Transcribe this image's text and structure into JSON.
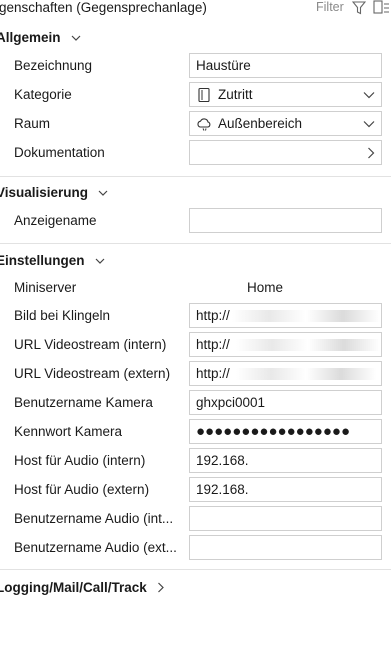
{
  "header": {
    "title": "igenschaften (Gegensprechanlage)",
    "filter_label": "Filter"
  },
  "sections": {
    "allgemein": "Allgemein",
    "visualisierung": "Visualisierung",
    "einstellungen": "Einstellungen",
    "logging": "Logging/Mail/Call/Track"
  },
  "allgemein": {
    "bezeichnung_label": "Bezeichnung",
    "bezeichnung_value": "Haustüre",
    "kategorie_label": "Kategorie",
    "kategorie_value": "Zutritt",
    "raum_label": "Raum",
    "raum_value": "Außenbereich",
    "dokumentation_label": "Dokumentation",
    "dokumentation_value": ""
  },
  "visualisierung": {
    "anzeigename_label": "Anzeigename",
    "anzeigename_value": ""
  },
  "einstellungen": {
    "miniserver_label": "Miniserver",
    "miniserver_value": "Home",
    "bild_label": "Bild bei Klingeln",
    "bild_value": "http://",
    "url_intern_label": "URL Videostream (intern)",
    "url_intern_value": "http://",
    "url_extern_label": "URL Videostream (extern)",
    "url_extern_value": "http://",
    "user_kamera_label": "Benutzername Kamera",
    "user_kamera_value": "ghxpci0001",
    "pw_kamera_label": "Kennwort Kamera",
    "pw_kamera_value": "●●●●●●●●●●●●●●●●●",
    "host_intern_label": "Host für Audio (intern)",
    "host_intern_value": "192.168.",
    "host_extern_label": "Host für Audio (extern)",
    "host_extern_value": "192.168.",
    "user_audio_intern_label": "Benutzername Audio (int...",
    "user_audio_intern_value": "",
    "user_audio_extern_label": "Benutzername Audio (ext...",
    "user_audio_extern_value": ""
  },
  "icons": {
    "filter": "filter-icon",
    "split": "split-view-icon",
    "kategorie": "door-icon",
    "raum": "cloud-sun-icon",
    "chevron": "chevron-down-icon",
    "arrow": "chevron-right-icon"
  }
}
